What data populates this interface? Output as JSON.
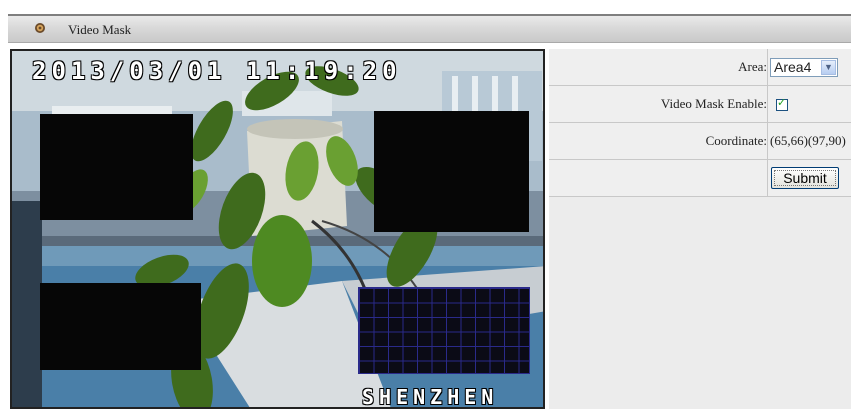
{
  "window": {
    "title": "Video Mask",
    "icon": "settings-gear-icon"
  },
  "video": {
    "timestamp": "2013/03/01 11:19:20",
    "city_overlay": "SHENZHEN",
    "mask_colors": {
      "solid": "#060606",
      "grid_line": "#2a2a8a"
    }
  },
  "form": {
    "area_label": "Area:",
    "area_value": "Area4",
    "mask_enable_label": "Video Mask Enable:",
    "mask_enable_checked": true,
    "coordinate_label": "Coordinate:",
    "coordinate_value": "(65,66)(97,90)",
    "submit_label": "Submit"
  }
}
